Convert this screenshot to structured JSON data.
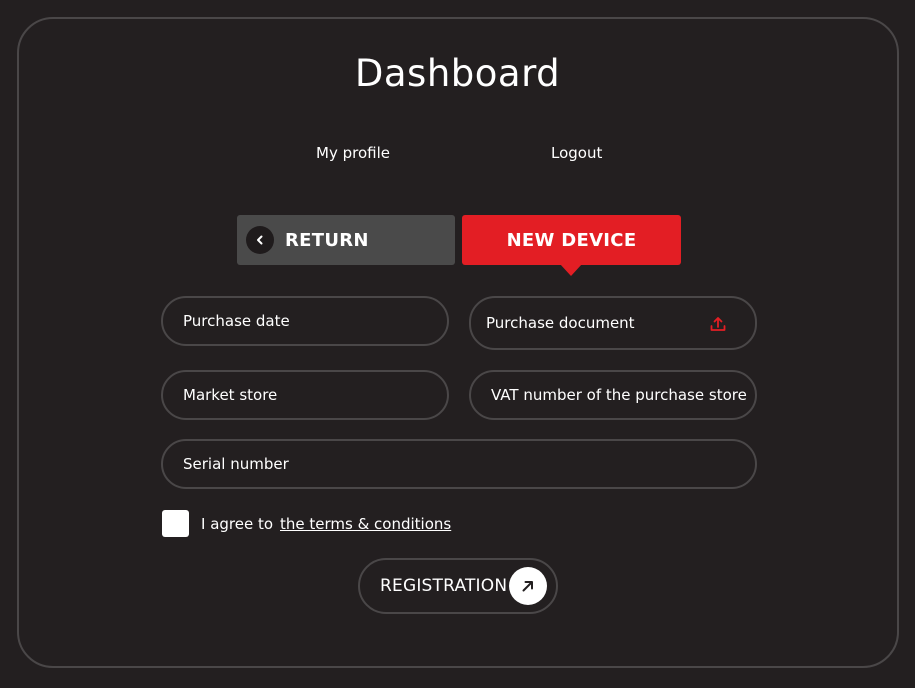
{
  "page": {
    "title": "Dashboard"
  },
  "nav": {
    "profile": "My profile",
    "logout": "Logout"
  },
  "tabs": {
    "return_label": "RETURN",
    "new_device_label": "NEW DEVICE"
  },
  "form": {
    "purchase_date": "Purchase date",
    "purchase_document": "Purchase document",
    "market_store": "Market store",
    "vat_number": "VAT number of the purchase store",
    "serial_number": "Serial number",
    "agree_text": "I agree to",
    "terms_link": "the terms & conditions",
    "terms_checked": false,
    "register_label": "REGISTRATION"
  },
  "colors": {
    "background": "#231f20",
    "accent": "#e31e24",
    "return_button": "#4a4a4a",
    "border": "#4a4748"
  },
  "icons": {
    "back": "chevron-left-icon",
    "upload": "upload-icon",
    "register": "arrow-up-right-icon"
  }
}
